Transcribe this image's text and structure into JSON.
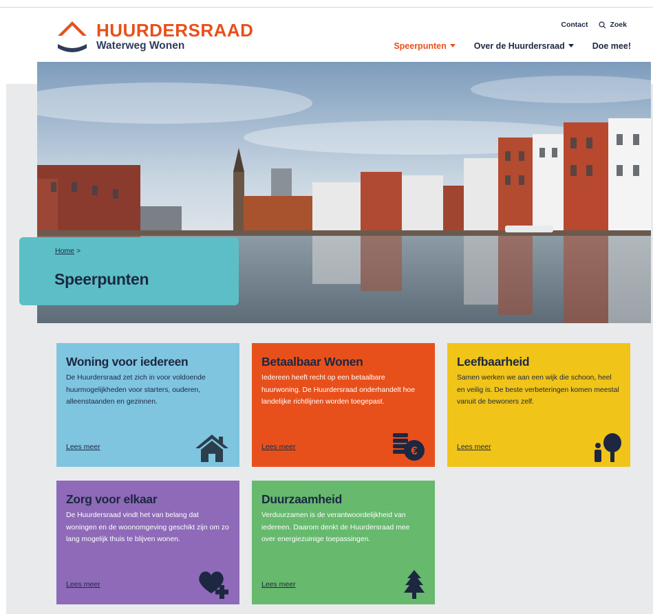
{
  "header": {
    "brand": "HUURDERSRAAD",
    "subtitle": "Waterweg Wonen",
    "utility": {
      "contact": "Contact",
      "search": "Zoek"
    },
    "nav": [
      {
        "label": "Speerpunten",
        "active": true,
        "dropdown": true
      },
      {
        "label": "Over de Huurdersraad",
        "active": false,
        "dropdown": true
      },
      {
        "label": "Doe mee!",
        "active": false,
        "dropdown": false
      }
    ]
  },
  "hero": {
    "breadcrumb_home": "Home",
    "breadcrumb_sep": ">",
    "title": "Speerpunten"
  },
  "cards": [
    {
      "title": "Woning voor iedereen",
      "text": "De Huurdersraad zet zich in voor voldoende huurmogelijkheden voor starters, ouderen, alleenstaanden en gezinnen.",
      "link": "Lees meer",
      "icon": "house-icon",
      "color": "#7fc5e0"
    },
    {
      "title": "Betaalbaar Wonen",
      "text": "Iedereen heeft recht op een betaalbare huurwoning. De Huurdersraad onderhandelt hoe landelijke richtlijnen worden toegepast.",
      "link": "Lees meer",
      "icon": "euro-coins-icon",
      "color": "#e8501b"
    },
    {
      "title": "Leefbaarheid",
      "text": "Samen werken we aan een wijk die schoon, heel en veilig is. De beste verbeteringen komen meestal vanuit de bewoners zelf.",
      "link": "Lees meer",
      "icon": "person-tree-icon",
      "color": "#f0c419"
    },
    {
      "title": "Zorg voor elkaar",
      "text": "De Huurdersraad vindt het van belang dat woningen en de woonomgeving geschikt zijn om zo lang mogelijk thuis te blijven wonen.",
      "link": "Lees meer",
      "icon": "heart-plus-icon",
      "color": "#8e6ab8"
    },
    {
      "title": "Duurzaamheid",
      "text": "Verduurzamen is de verantwoordelijkheid van iedereen. Daarom denkt de Huurdersraad mee over energiezuinige toepassingen.",
      "link": "Lees meer",
      "icon": "pine-tree-icon",
      "color": "#66b96d"
    }
  ],
  "colors": {
    "accent": "#e8501b",
    "navy": "#1d2741",
    "teal": "#5cbfc7"
  }
}
